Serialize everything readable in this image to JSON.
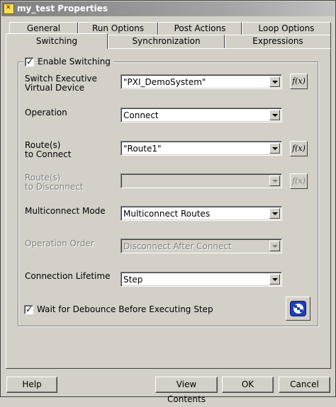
{
  "window": {
    "title": "my_test Properties",
    "icon": "app-icon"
  },
  "tabs": {
    "row1": [
      "General",
      "Run Options",
      "Post Actions",
      "Loop Options"
    ],
    "row2": [
      "Switching",
      "Synchronization",
      "Expressions"
    ],
    "active": "Switching"
  },
  "switching": {
    "enable_label": "Enable Switching",
    "enable_checked": true,
    "fields": [
      {
        "label_line1": "Switch Executive",
        "label_line2": "Virtual Device",
        "value": "\"PXI_DemoSystem\"",
        "enabled": true,
        "has_fx": true
      },
      {
        "label_line1": "Operation",
        "label_line2": "",
        "value": "Connect",
        "enabled": true,
        "has_fx": false
      },
      {
        "label_line1": "Route(s)",
        "label_line2": "to Connect",
        "value": "\"Route1\"",
        "enabled": true,
        "has_fx": true
      },
      {
        "label_line1": "Route(s)",
        "label_line2": "to Disconnect",
        "value": "",
        "enabled": false,
        "has_fx": true
      },
      {
        "label_line1": "Multiconnect Mode",
        "label_line2": "",
        "value": "Multiconnect Routes",
        "enabled": true,
        "has_fx": false
      },
      {
        "label_line1": "Operation Order",
        "label_line2": "",
        "value": "Disconnect After Connect",
        "enabled": false,
        "has_fx": false
      },
      {
        "label_line1": "Connection Lifetime",
        "label_line2": "",
        "value": "Step",
        "enabled": true,
        "has_fx": false
      }
    ],
    "fx_label": "f(x)",
    "debounce_label": "Wait for Debounce Before Executing Step",
    "debounce_checked": true,
    "check_glyph": "✓"
  },
  "footer": {
    "help": "Help",
    "view_contents": "View Contents",
    "ok": "OK",
    "cancel": "Cancel"
  },
  "colors": {
    "face": "#d4d0c8",
    "titlebar": "#808080",
    "disabled_text": "#808080"
  }
}
